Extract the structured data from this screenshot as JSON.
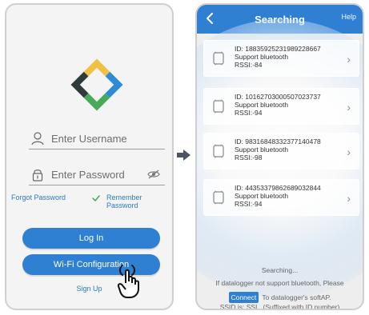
{
  "login": {
    "username_placeholder": "Enter Username",
    "password_placeholder": "Enter Password",
    "forgot_password": "Forgot Password",
    "remember_password": "Remember Password",
    "login_button": "Log In",
    "wifi_config_button": "Wi-Fi Configuration",
    "sign_up": "Sign Up",
    "accent": "#2f7fd2"
  },
  "search": {
    "title": "Searching",
    "help": "Help",
    "devices": [
      {
        "id": "ID: 18835925231989228667",
        "support": "Support bluetooth",
        "rssi": "RSSI:-84"
      },
      {
        "id": "ID: 10162703000507023737",
        "support": "Support bluetooth",
        "rssi": "RSSI:-94"
      },
      {
        "id": "ID: 98316848332377140478",
        "support": "Support bluetooth",
        "rssi": "RSSI:-98"
      },
      {
        "id": "ID: 44353379862689032844",
        "support": "Support bluetooth",
        "rssi": "RSSI:-94"
      }
    ],
    "status": "Searching...",
    "hint_line1": "If datalogger not support bluetooth, Please",
    "connect_label": "Connect",
    "hint_line2_suffix": "To datalogger's softAP.",
    "ssid_hint": "SSID is: SSL_(Suffixed with ID number)",
    "accent": "#2f7fd2"
  },
  "icons": {
    "user": "user-icon",
    "lock": "lock-icon",
    "eye": "eye-off-icon",
    "check": "check-icon",
    "arrow": "arrow-right-icon",
    "back": "chevron-left-icon",
    "chevron": "chevron-right-icon",
    "device": "device-icon",
    "hand": "hand-pointer-icon"
  }
}
